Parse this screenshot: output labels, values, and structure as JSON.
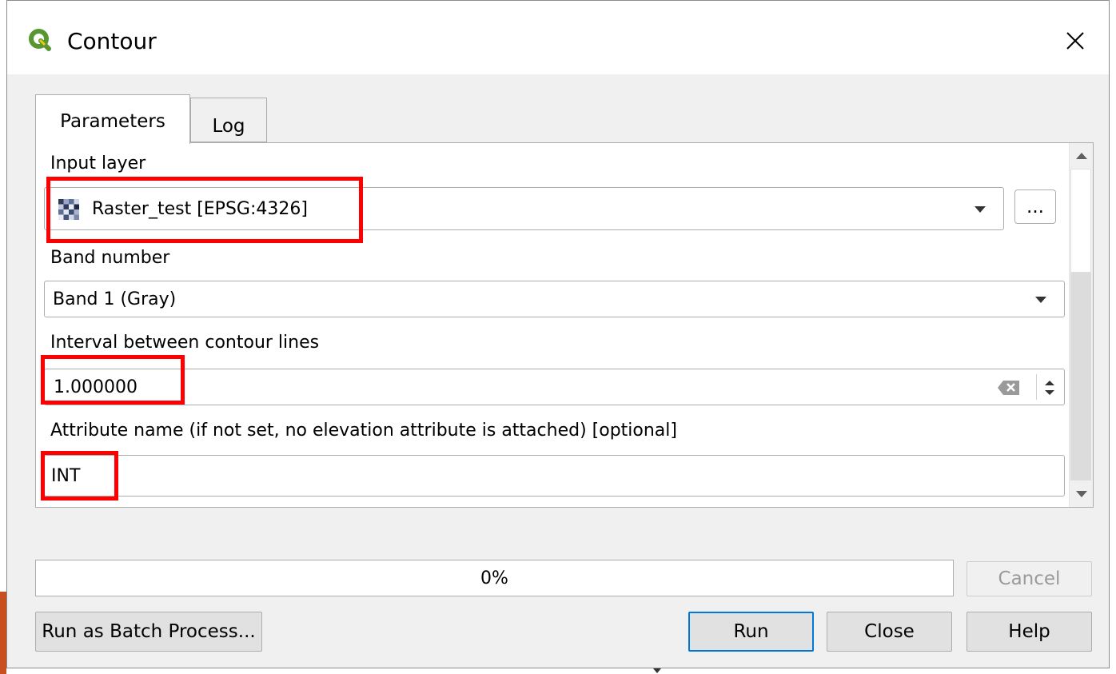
{
  "window": {
    "title": "Contour",
    "app_icon": "qgis-logo-icon",
    "close_icon": "close-icon"
  },
  "tabs": [
    {
      "label": "Parameters",
      "active": true
    },
    {
      "label": "Log",
      "active": false
    }
  ],
  "params": {
    "input_layer": {
      "label": "Input layer",
      "value": "Raster_test [EPSG:4326]",
      "icon": "raster-layer-icon",
      "browse_label": "..."
    },
    "band_number": {
      "label": "Band number",
      "value": "Band 1 (Gray)"
    },
    "interval": {
      "label": "Interval between contour lines",
      "value": "1.000000",
      "clear_icon": "clear-icon",
      "spin_icon": "spin-arrows-icon"
    },
    "attribute_name": {
      "label": "Attribute name (if not set, no elevation attribute is attached) [optional]",
      "value": "INT"
    }
  },
  "progress": {
    "text": "0%",
    "value": 0
  },
  "buttons": {
    "cancel": "Cancel",
    "batch": "Run as Batch Process...",
    "run": "Run",
    "close": "Close",
    "help": "Help"
  },
  "colors": {
    "highlight": "#ff0000",
    "qgis_green": "#589632",
    "qgis_yellow": "#eec90d"
  }
}
